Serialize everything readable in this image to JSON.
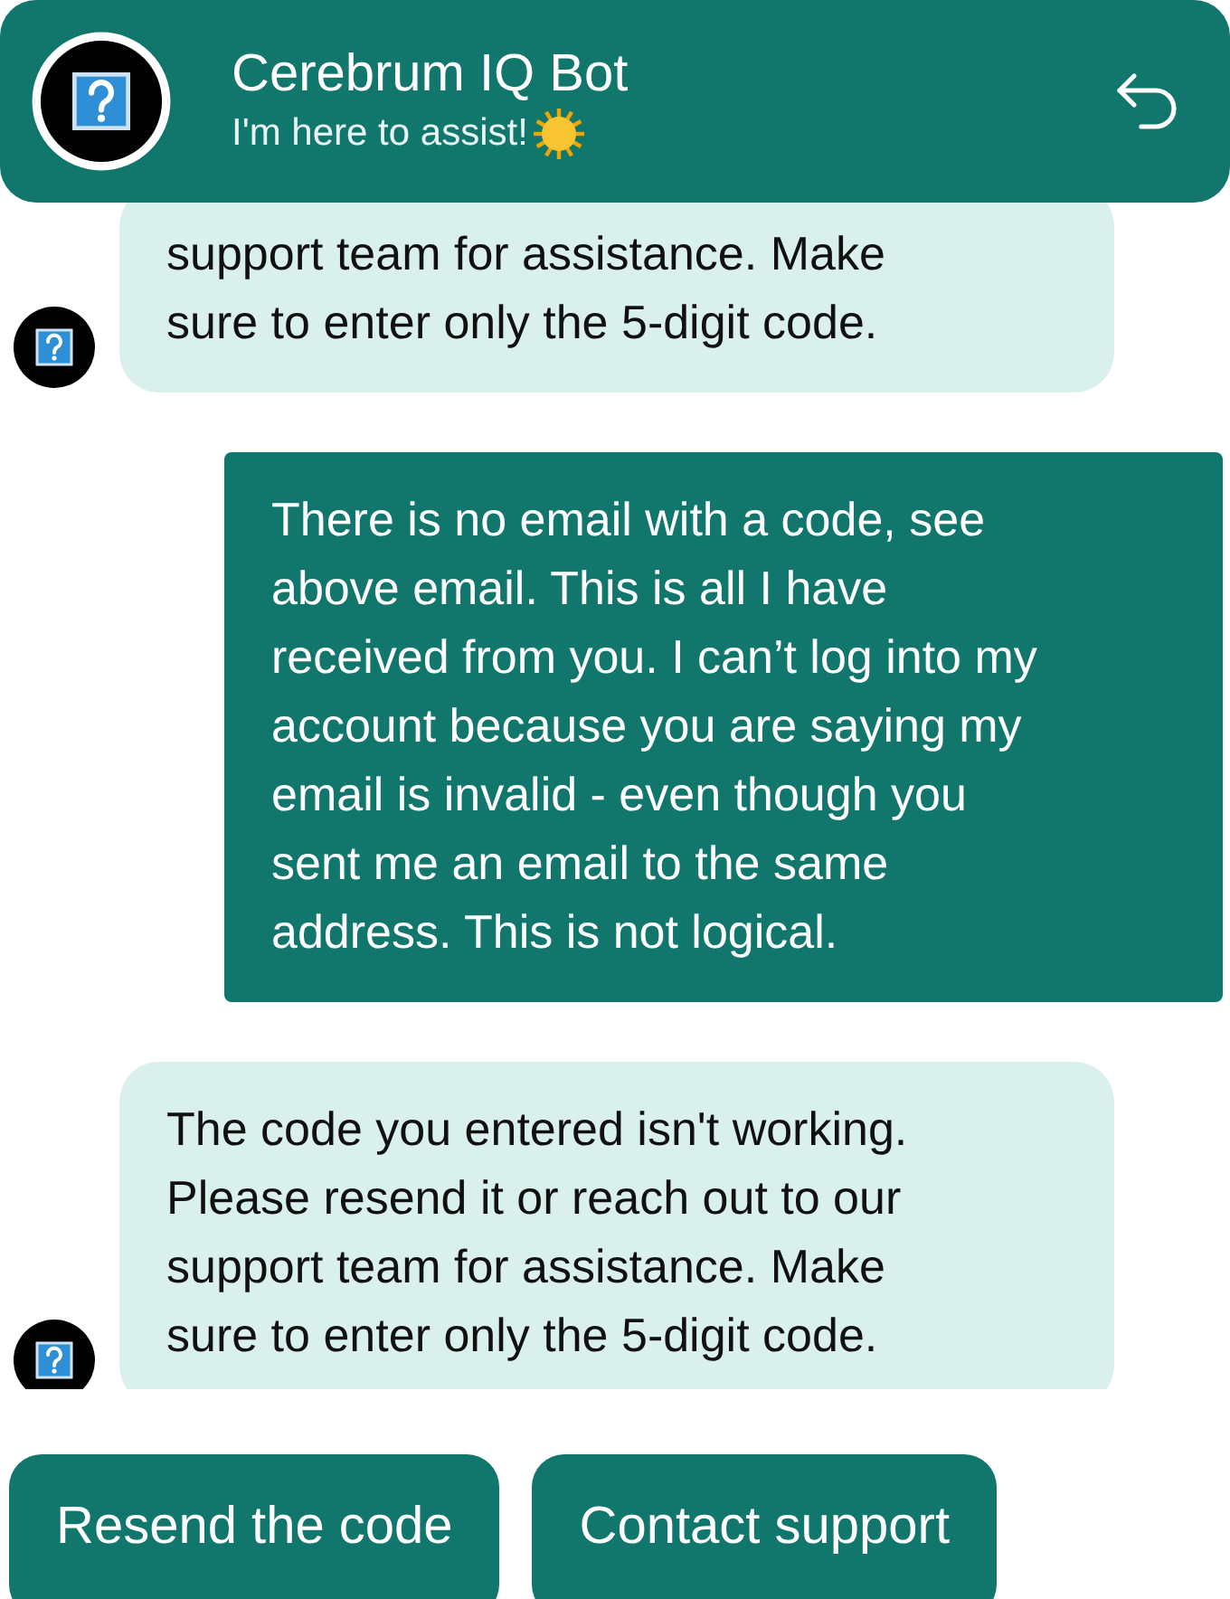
{
  "header": {
    "title": "Cerebrum IQ Bot",
    "subtitle": "I'm here to assist!"
  },
  "messages": [
    {
      "kind": "bot",
      "text": "support team for assistance. Make\nsure to enter only the 5-digit code."
    },
    {
      "kind": "user",
      "text": "There is no email with a code, see\nabove email. This is all I have\nreceived from you. I can’t log into my\naccount because you are saying my\nemail is invalid - even though you\nsent me an email to the same\naddress. This is not logical."
    },
    {
      "kind": "bot",
      "text": "The code you entered isn't working.\nPlease resend it or reach out to our\nsupport team for assistance. Make\nsure to enter only the 5-digit code."
    }
  ],
  "quick_replies": [
    "Resend the code",
    "Contact support"
  ]
}
